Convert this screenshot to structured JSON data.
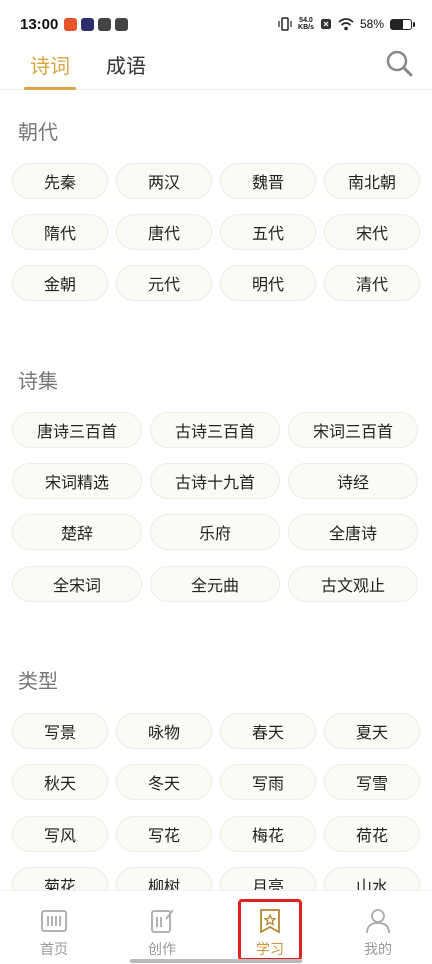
{
  "status_bar": {
    "time": "13:00",
    "net_speed_value": "54.0",
    "net_speed_unit": "KB/s",
    "battery": "58%",
    "battery_level": 0.58
  },
  "tabs": [
    {
      "label": "诗词",
      "active": true
    },
    {
      "label": "成语",
      "active": false
    }
  ],
  "sections": {
    "dynasty": {
      "title": "朝代",
      "items": [
        "先秦",
        "两汉",
        "魏晋",
        "南北朝",
        "隋代",
        "唐代",
        "五代",
        "宋代",
        "金朝",
        "元代",
        "明代",
        "清代"
      ]
    },
    "collections": {
      "title": "诗集",
      "items": [
        "唐诗三百首",
        "古诗三百首",
        "宋词三百首",
        "宋词精选",
        "古诗十九首",
        "诗经",
        "楚辞",
        "乐府",
        "全唐诗",
        "全宋词",
        "全元曲",
        "古文观止"
      ]
    },
    "types": {
      "title": "类型",
      "items": [
        "写景",
        "咏物",
        "春天",
        "夏天",
        "秋天",
        "冬天",
        "写雨",
        "写雪",
        "写风",
        "写花",
        "梅花",
        "荷花",
        "菊花",
        "柳树",
        "月亮",
        "山水"
      ]
    }
  },
  "bottom_nav": [
    {
      "label": "首页",
      "icon": "home-icon",
      "active": false
    },
    {
      "label": "创作",
      "icon": "create-icon",
      "active": false
    },
    {
      "label": "学习",
      "icon": "study-icon",
      "active": true
    },
    {
      "label": "我的",
      "icon": "profile-icon",
      "active": false
    }
  ],
  "colors": {
    "accent": "#d9a441",
    "highlight": "#e02020",
    "chip_bg": "#fbfaf5"
  }
}
